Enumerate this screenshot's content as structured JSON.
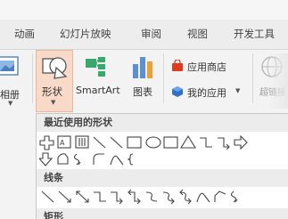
{
  "tabs": [
    "动画",
    "幻灯片放映",
    "审阅",
    "视图",
    "开发工具"
  ],
  "ribbon": {
    "partial_left_label": "相册",
    "shapes_label": "形状",
    "smartart_label": "SmartArt",
    "chart_label": "图表",
    "app_store_label": "应用商店",
    "my_apps_label": "我的应用",
    "hyperlink_label": "超链接"
  },
  "dropdown": {
    "recent_header": "最近使用的形状",
    "lines_header": "线条",
    "rect_header": "矩形"
  },
  "colors": {
    "accent_shape_button": "#f9d9c8",
    "app_store_icon": "#e03b1f",
    "my_apps_icon": "#2c72c7",
    "chart_bar_blue": "#5b8fd6",
    "chart_bar_orange": "#f0a030"
  }
}
